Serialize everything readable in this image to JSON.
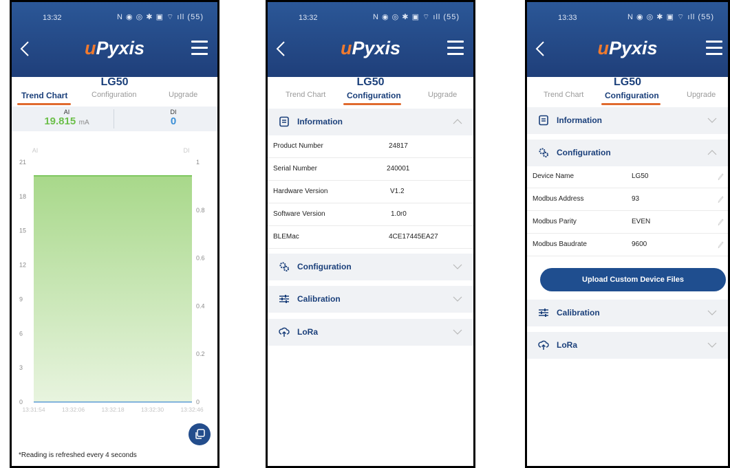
{
  "app": {
    "logo_u": "u",
    "logo_rest": "Pyxis",
    "device": "LG50",
    "tabs": [
      "Trend Chart",
      "Configuration",
      "Upgrade"
    ],
    "status_icons": "N ◉ ◎ ✱ ▣ ⌔ ıll (55)"
  },
  "screens": [
    {
      "time": "13:32",
      "active_tab": "Trend Chart",
      "readings": {
        "ai_label": "AI",
        "ai_value": "19.815",
        "ai_unit": "mA",
        "di_label": "DI",
        "di_value": "0"
      },
      "chart_data": {
        "type": "area",
        "x": [
          "13:31:54",
          "13:32:06",
          "13:32:18",
          "13:32:30",
          "13:32:46"
        ],
        "series": [
          {
            "name": "AI",
            "values": [
              19.815,
              19.815,
              19.815,
              19.815,
              19.815
            ],
            "axis": "left"
          },
          {
            "name": "DI",
            "values": [
              0,
              0,
              0,
              0,
              0
            ],
            "axis": "right"
          }
        ],
        "left_axis_label": "AI",
        "right_axis_label": "DI",
        "ylim_left": [
          0,
          21
        ],
        "yticks_left": [
          "21",
          "18",
          "15",
          "12",
          "9",
          "6",
          "3",
          "0"
        ],
        "ylim_right": [
          0,
          1
        ],
        "yticks_right": [
          "1",
          "0.8",
          "0.6",
          "0.4",
          "0.2",
          "0"
        ],
        "colors": {
          "ai_fill_top": "#a8d88a",
          "ai_fill_bottom": "#e8f4df",
          "ai_line": "#6cbf4a",
          "di_line": "#5b9bd5"
        }
      },
      "footer_note": "*Reading is refreshed every 4 seconds"
    },
    {
      "time": "13:32",
      "active_tab": "Configuration",
      "sections": [
        {
          "title": "Information",
          "icon": "document-icon",
          "expanded": true,
          "rows": [
            {
              "label": "Product Number",
              "value": "24817"
            },
            {
              "label": "Serial Number",
              "value": "240001"
            },
            {
              "label": "Hardware Version",
              "value": "V1.2"
            },
            {
              "label": "Software Version",
              "value": "1.0r0"
            },
            {
              "label": "BLEMac",
              "value": "4CE17445EA27"
            }
          ]
        },
        {
          "title": "Configuration",
          "icon": "gears-icon",
          "expanded": false
        },
        {
          "title": "Calibration",
          "icon": "sliders-icon",
          "expanded": false
        },
        {
          "title": "LoRa",
          "icon": "cloud-upload-icon",
          "expanded": false
        }
      ]
    },
    {
      "time": "13:33",
      "active_tab": "Configuration",
      "sections": [
        {
          "title": "Information",
          "icon": "document-icon",
          "expanded": false
        },
        {
          "title": "Configuration",
          "icon": "gears-icon",
          "expanded": true,
          "rows": [
            {
              "label": "Device Name",
              "value": "LG50"
            },
            {
              "label": "Modbus Address",
              "value": "93"
            },
            {
              "label": "Modbus Parity",
              "value": "EVEN"
            },
            {
              "label": "Modbus Baudrate",
              "value": "9600"
            }
          ]
        },
        {
          "title": "Calibration",
          "icon": "sliders-icon",
          "expanded": false
        },
        {
          "title": "LoRa",
          "icon": "cloud-upload-icon",
          "expanded": false
        }
      ],
      "upload_button": "Upload Custom Device Files"
    }
  ],
  "colors": {
    "header": "#234d8c",
    "accent": "#e06a2e",
    "title": "#1a3f7a",
    "ai_value": "#6cbf4a",
    "di_value": "#3a8fd6"
  }
}
